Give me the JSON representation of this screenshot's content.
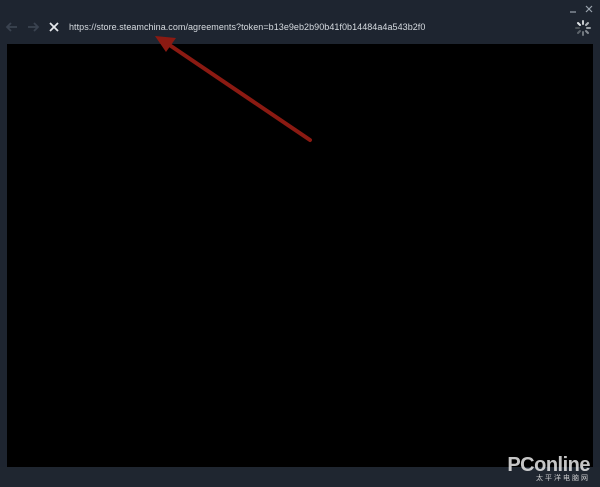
{
  "window": {
    "minimize_symbol": "_",
    "close_symbol": "✕"
  },
  "toolbar": {
    "back_icon": "arrow-left-icon",
    "forward_icon": "arrow-right-icon",
    "stop_icon": "close-icon",
    "url": "https://store.steamchina.com/agreements?token=b13e9eb2b90b41f0b14484a4a543b2f0",
    "loading_icon": "spinner-icon"
  },
  "colors": {
    "chrome_bg": "#1e2530",
    "content_bg": "#000000",
    "annotation_arrow": "#8b1a12",
    "url_text": "#d6dbe0"
  },
  "watermark": {
    "main": "PConline",
    "sub": "太平洋电脑网"
  }
}
